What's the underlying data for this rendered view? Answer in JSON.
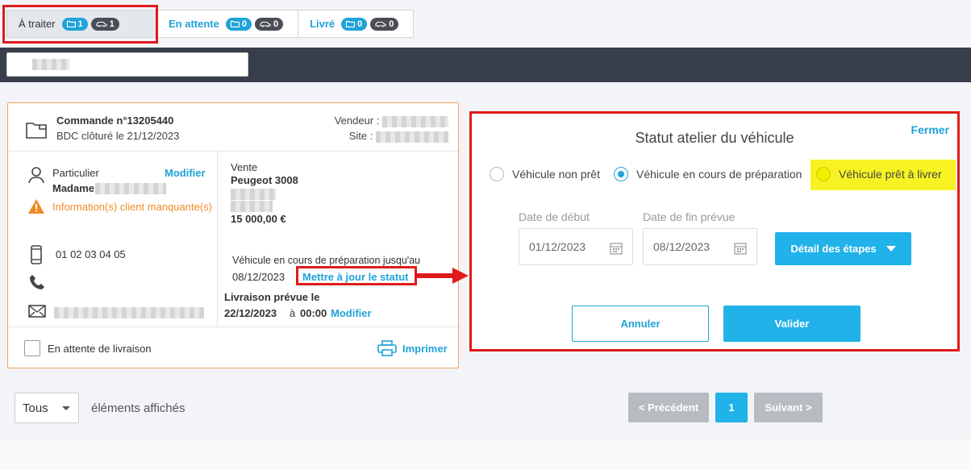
{
  "tabs": [
    {
      "label": "À traiter",
      "count_folders": "1",
      "count_cars": "1",
      "active": true
    },
    {
      "label": "En attente",
      "count_folders": "0",
      "count_cars": "0",
      "active": false
    },
    {
      "label": "Livré",
      "count_folders": "0",
      "count_cars": "0",
      "active": false
    }
  ],
  "search": {
    "value": ""
  },
  "order": {
    "title": "Commande n°13205440",
    "subtitle": "BDC clôturé le 21/12/2023",
    "vendeur_label": "Vendeur :",
    "site_label": "Site :",
    "client_type": "Particulier",
    "modify_label": "Modifier",
    "client_name": "Madame",
    "warning": "Information(s) client manquante(s)",
    "phone": "01 02 03 04 05",
    "sale_type": "Vente",
    "vehicle": "Peugeot 3008",
    "price": "15 000,00 €",
    "status_text": "Véhicule en cours de préparation jusqu'au",
    "status_date": "08/12/2023",
    "update_status": "Mettre à jour le statut",
    "delivery_label": "Livraison prévue le",
    "delivery_date": "22/12/2023",
    "delivery_at": "à",
    "delivery_time": "00:00",
    "delivery_modify": "Modifier",
    "waiting_label": "En attente de livraison",
    "print_label": "Imprimer"
  },
  "modal": {
    "title": "Statut atelier du véhicule",
    "close_label": "Fermer",
    "options": [
      "Véhicule non prêt",
      "Véhicule en cours de préparation",
      "Véhicule prêt à livrer"
    ],
    "selected": 1,
    "start_label": "Date de début",
    "start_value": "01/12/2023",
    "end_label": "Date de fin prévue",
    "end_value": "08/12/2023",
    "steps_label": "Détail des étapes",
    "cancel_label": "Annuler",
    "validate_label": "Valider"
  },
  "pagination": {
    "per_page": "Tous",
    "shown_label": "éléments affichés",
    "prev": "< Précédent",
    "current": "1",
    "next": "Suivant >"
  },
  "colors": {
    "accent": "#1fa3d8",
    "warning": "#f08c26",
    "annotation": "#e01b1b",
    "highlight": "#f7f322"
  }
}
